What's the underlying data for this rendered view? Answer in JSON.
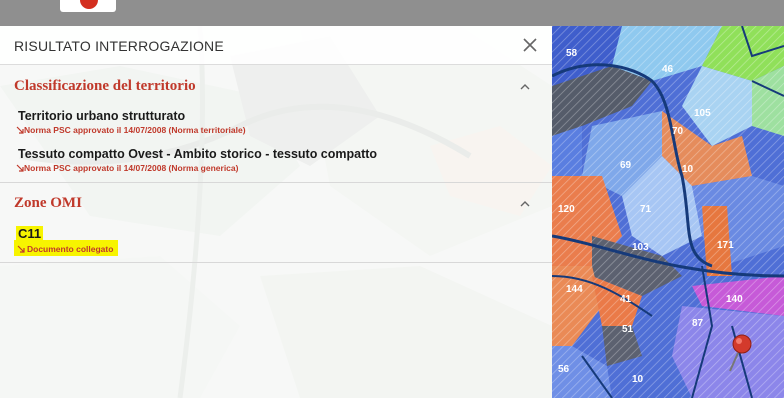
{
  "panel": {
    "title": "RISULTATO INTERROGAZIONE",
    "sections": [
      {
        "title": "Classificazione del territorio",
        "items": [
          {
            "title": "Territorio urbano strutturato",
            "link": "Norma PSC approvato il 14/07/2008 (Norma territoriale)"
          },
          {
            "title": "Tessuto compatto Ovest - Ambito storico - tessuto compatto",
            "link": "Norma PSC approvato il 14/07/2008 (Norma generica)"
          }
        ]
      },
      {
        "title": "Zone OMI",
        "items": [
          {
            "title": "C11",
            "link": "Documento collegato"
          }
        ]
      }
    ]
  },
  "map": {
    "labels": [
      "58",
      "46",
      "105",
      "70",
      "69",
      "10",
      "71",
      "120",
      "103",
      "171",
      "144",
      "41",
      "140",
      "51",
      "87",
      "56",
      "10"
    ]
  },
  "colors": {
    "accent": "#c0392b",
    "highlight": "#f7f400",
    "topbar": "#8f8f8f"
  }
}
